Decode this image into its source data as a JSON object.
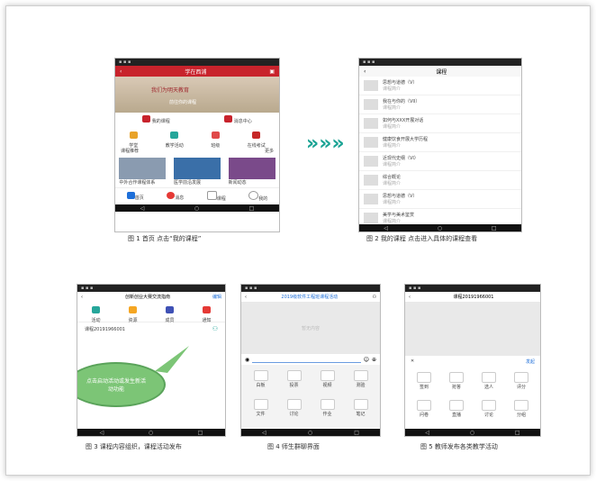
{
  "phone1": {
    "title": "学在西浦",
    "banner_text": "我们为明天教育",
    "greeting": "前往你的课程",
    "menu_a": "我的课程",
    "menu_b": "消息中心",
    "grid": [
      "学堂",
      "教学活动",
      "班级",
      "在线考试"
    ],
    "recommend_title": "课程推荐",
    "recommend_more": "更多",
    "cards": [
      "中外合作课程体系",
      "医学前沿发展",
      "新闻动态"
    ],
    "tabs": [
      "首页",
      "消息",
      "课程",
      "我的"
    ]
  },
  "caption1": "图 1 首页 点击“我的课程”",
  "arrow": "»»»",
  "phone2": {
    "title": "课程",
    "items": [
      {
        "name": "思想与道德（V）",
        "meta": "课程简介"
      },
      {
        "name": "我在与你的（VII）",
        "meta": "课程简介"
      },
      {
        "name": "如何与XXX开展对话",
        "meta": "课程简介"
      },
      {
        "name": "健康饮食开展大学历程",
        "meta": "课程简介"
      },
      {
        "name": "近现代史纲（VI）",
        "meta": "课程简介"
      },
      {
        "name": "综合概论",
        "meta": "课程简介"
      },
      {
        "name": "思想与道德（V）",
        "meta": "课程简介"
      },
      {
        "name": "美学与美术鉴赏",
        "meta": "课程简介"
      }
    ]
  },
  "caption2": "图 2 我的课程 点击进入具体的课程查看",
  "phone3": {
    "title": "创新创业大赛交流指南",
    "action": "编辑",
    "tabs": [
      "活动",
      "资源",
      "成员",
      "通知"
    ],
    "row_label": "课程20191966001",
    "bubble": "点击启动活动或发生新活动功能"
  },
  "caption3": "图 3 课程内容组织，课程活动发布",
  "phone4": {
    "title": "2019级软件工程班课程活动",
    "header_note": "暂无内容",
    "tools": [
      "白板",
      "投票",
      "视频",
      "测验",
      "文件",
      "讨论",
      "作业",
      "笔记"
    ]
  },
  "caption4": "图 4 师生群聊界面",
  "phone5": {
    "title": "课程20191966001",
    "action": "发起",
    "tools": [
      "签到",
      "抢答",
      "选人",
      "评分",
      "问卷",
      "直播",
      "讨论",
      "分组"
    ]
  },
  "caption5": "图 5 教师发布各类教学活动"
}
